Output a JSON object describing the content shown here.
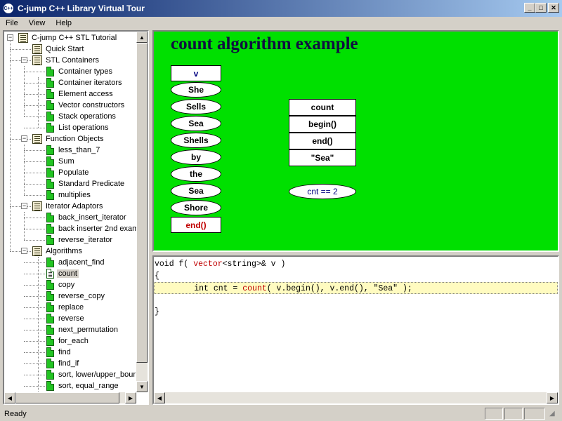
{
  "window": {
    "title": "C-jump C++ Library Virtual Tour",
    "app_icon_text": "C++",
    "minimize": "_",
    "maximize": "□",
    "close": "✕"
  },
  "menu": [
    "File",
    "View",
    "Help"
  ],
  "tree": {
    "root": "C-jump C++ STL Tutorial",
    "items": [
      {
        "label": "Quick Start",
        "level": 1,
        "type": "book"
      },
      {
        "label": "STL Containers",
        "level": 1,
        "type": "book",
        "expanded": true
      },
      {
        "label": "Container types",
        "level": 2,
        "type": "page"
      },
      {
        "label": "Container iterators",
        "level": 2,
        "type": "page"
      },
      {
        "label": "Element access",
        "level": 2,
        "type": "page"
      },
      {
        "label": "Vector constructors",
        "level": 2,
        "type": "page"
      },
      {
        "label": "Stack operations",
        "level": 2,
        "type": "page"
      },
      {
        "label": "List operations",
        "level": 2,
        "type": "page"
      },
      {
        "label": "Function Objects",
        "level": 1,
        "type": "book",
        "expanded": true
      },
      {
        "label": "less_than_7",
        "level": 2,
        "type": "page"
      },
      {
        "label": "Sum",
        "level": 2,
        "type": "page"
      },
      {
        "label": "Populate",
        "level": 2,
        "type": "page"
      },
      {
        "label": "Standard Predicate",
        "level": 2,
        "type": "page"
      },
      {
        "label": "multiplies",
        "level": 2,
        "type": "page"
      },
      {
        "label": "Iterator Adaptors",
        "level": 1,
        "type": "book",
        "expanded": true
      },
      {
        "label": "back_insert_iterator",
        "level": 2,
        "type": "page"
      },
      {
        "label": "back inserter 2nd exam",
        "level": 2,
        "type": "page"
      },
      {
        "label": "reverse_iterator",
        "level": 2,
        "type": "page"
      },
      {
        "label": "Algorithms",
        "level": 1,
        "type": "book",
        "expanded": true
      },
      {
        "label": "adjacent_find",
        "level": 2,
        "type": "page"
      },
      {
        "label": "count",
        "level": 2,
        "type": "page",
        "selected": true
      },
      {
        "label": "copy",
        "level": 2,
        "type": "page"
      },
      {
        "label": "reverse_copy",
        "level": 2,
        "type": "page"
      },
      {
        "label": "replace",
        "level": 2,
        "type": "page"
      },
      {
        "label": "reverse",
        "level": 2,
        "type": "page"
      },
      {
        "label": "next_permutation",
        "level": 2,
        "type": "page"
      },
      {
        "label": "for_each",
        "level": 2,
        "type": "page"
      },
      {
        "label": "find",
        "level": 2,
        "type": "page"
      },
      {
        "label": "find_if",
        "level": 2,
        "type": "page"
      },
      {
        "label": "sort, lower/upper_bour",
        "level": 2,
        "type": "page"
      },
      {
        "label": "sort, equal_range",
        "level": 2,
        "type": "page"
      }
    ]
  },
  "diagram": {
    "title": "count algorithm example",
    "background": "#00e000",
    "vector_label": "v",
    "elements": [
      "She",
      "Sells",
      "Sea",
      "Shells",
      "by",
      "the",
      "Sea",
      "Shore"
    ],
    "end_label": "end()",
    "call_box": [
      "count",
      "begin()",
      "end()",
      "\"Sea\""
    ],
    "result": "cnt == 2",
    "accent_blue": "#000080",
    "accent_red": "#c00000"
  },
  "code": {
    "line1_a": "void f( ",
    "line1_kw": "vector",
    "line1_b": "<string>& v )",
    "line2": "{",
    "line3_a": "        int cnt = ",
    "line3_kw": "count",
    "line3_b": "( v.begin(), v.end(), \"Sea\" );",
    "line4": "",
    "line5": "}"
  },
  "status": {
    "text": "Ready"
  }
}
